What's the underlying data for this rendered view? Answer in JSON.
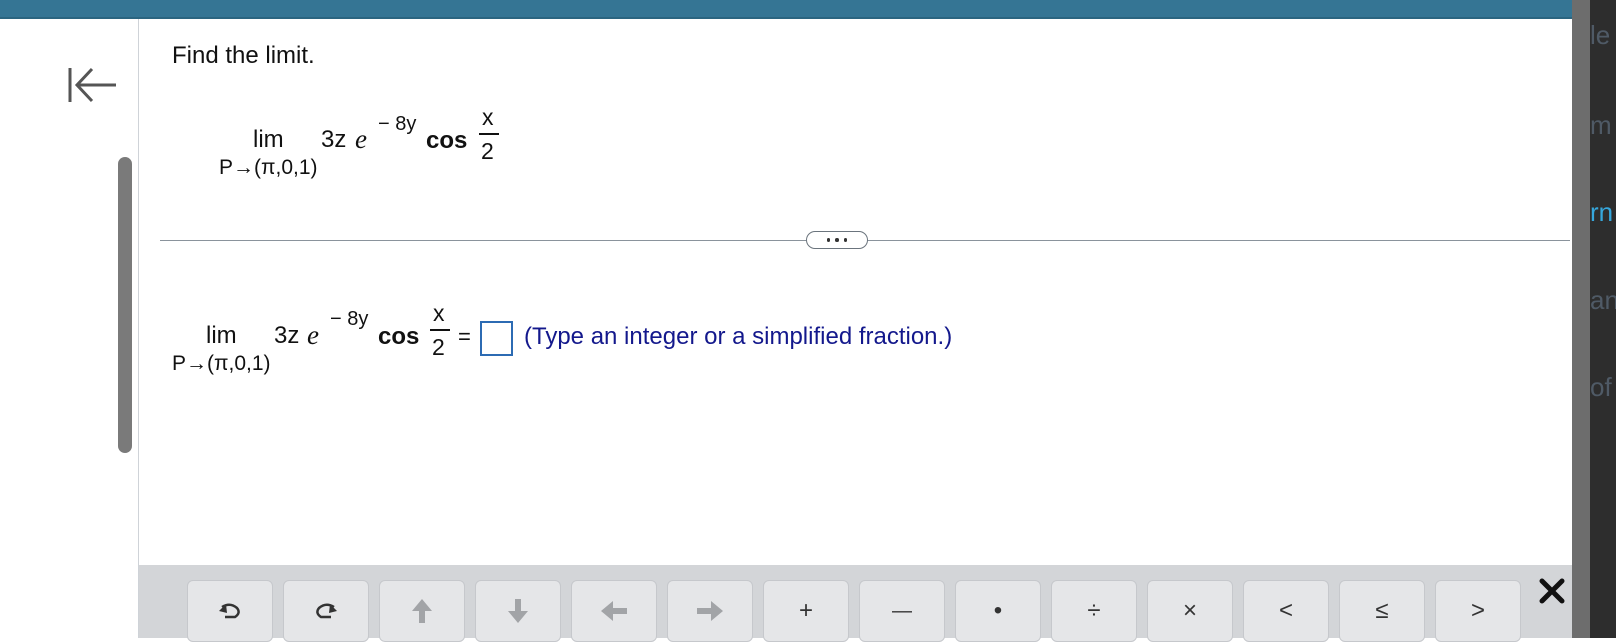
{
  "question": {
    "title": "Find the limit.",
    "expression": {
      "lim": "lim",
      "subscript": "P→(π,0,1)",
      "coefficient": "3z",
      "base": "e",
      "exponent": "− 8y",
      "func": "cos",
      "numerator": "x",
      "denominator": "2"
    }
  },
  "answer": {
    "equals": "=",
    "value": "",
    "hint": "(Type an integer or a simplified fraction.)"
  },
  "palette": {
    "buttons": [
      {
        "name": "undo-button",
        "icon": "undo-icon"
      },
      {
        "name": "redo-button",
        "icon": "redo-icon"
      },
      {
        "name": "move-up-button",
        "icon": "arrow-up-icon"
      },
      {
        "name": "move-down-button",
        "icon": "arrow-down-icon"
      },
      {
        "name": "move-left-button",
        "icon": "arrow-left-icon"
      },
      {
        "name": "move-right-button",
        "icon": "arrow-right-icon"
      },
      {
        "name": "plus-button",
        "label": "+"
      },
      {
        "name": "minus-button",
        "label": "—"
      },
      {
        "name": "dot-button",
        "label": "•"
      },
      {
        "name": "divide-button",
        "label": "÷"
      },
      {
        "name": "times-button",
        "label": "×"
      },
      {
        "name": "less-than-button",
        "label": "<"
      },
      {
        "name": "less-or-equal-button",
        "label": "≤"
      },
      {
        "name": "greater-than-button",
        "label": ">"
      }
    ]
  },
  "colors": {
    "topbar": "#357594",
    "hint_text": "#13188c",
    "answer_box_border": "#2c6bb3",
    "palette_background": "#d3d5d8"
  },
  "right_edge_fragments": [
    "le",
    "m",
    "rn",
    "an",
    "of"
  ]
}
